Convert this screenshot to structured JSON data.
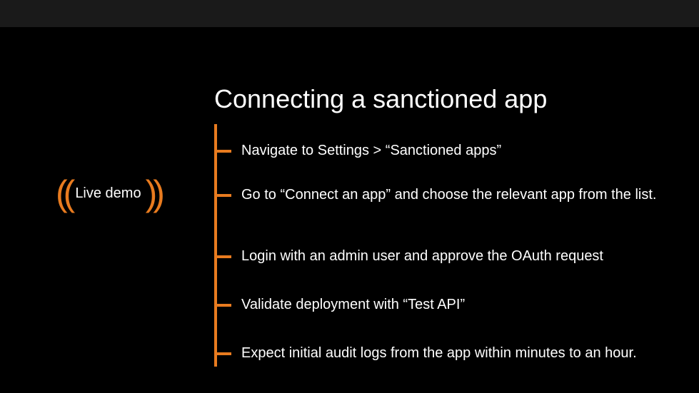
{
  "title": "Connecting a sanctioned app",
  "demo_label": "Live demo",
  "steps": [
    "Navigate to Settings > “Sanctioned apps”",
    "Go to “Connect an app” and choose the relevant app from the list.",
    "Login with an admin user and approve the OAuth request",
    "Validate deployment with “Test API”",
    "Expect initial audit logs from the app within minutes to an hour."
  ],
  "accent_color": "#E87B1F"
}
